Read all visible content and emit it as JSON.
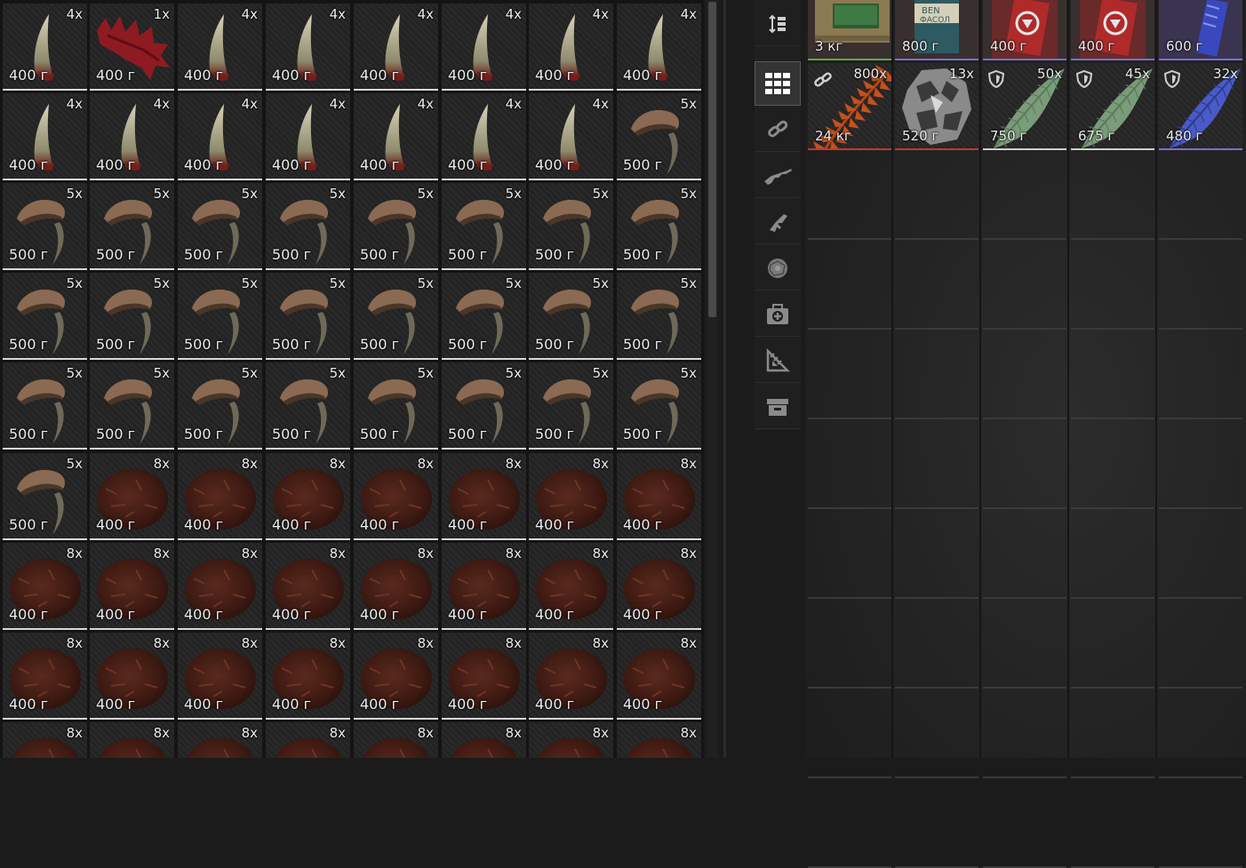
{
  "inventory": {
    "rows": [
      [
        {
          "icon": "fang-icon",
          "count": "4x",
          "weight": "400 г"
        },
        {
          "icon": "red-spine-icon",
          "count": "1x",
          "weight": "400 г"
        },
        {
          "icon": "fang-icon",
          "count": "4x",
          "weight": "400 г"
        },
        {
          "icon": "fang-icon",
          "count": "4x",
          "weight": "400 г"
        },
        {
          "icon": "fang-icon",
          "count": "4x",
          "weight": "400 г"
        },
        {
          "icon": "fang-icon",
          "count": "4x",
          "weight": "400 г"
        },
        {
          "icon": "fang-icon",
          "count": "4x",
          "weight": "400 г"
        },
        {
          "icon": "fang-icon",
          "count": "4x",
          "weight": "400 г"
        }
      ],
      [
        {
          "icon": "fang-icon",
          "count": "4x",
          "weight": "400 г"
        },
        {
          "icon": "fang-icon",
          "count": "4x",
          "weight": "400 г"
        },
        {
          "icon": "fang-icon",
          "count": "4x",
          "weight": "400 г"
        },
        {
          "icon": "fang-icon",
          "count": "4x",
          "weight": "400 г"
        },
        {
          "icon": "fang-icon",
          "count": "4x",
          "weight": "400 г"
        },
        {
          "icon": "fang-icon",
          "count": "4x",
          "weight": "400 г"
        },
        {
          "icon": "fang-icon",
          "count": "4x",
          "weight": "400 г"
        },
        {
          "icon": "claw-icon",
          "count": "5x",
          "weight": "500 г"
        }
      ],
      [
        {
          "icon": "claw-icon",
          "count": "5x",
          "weight": "500 г"
        },
        {
          "icon": "claw-icon",
          "count": "5x",
          "weight": "500 г"
        },
        {
          "icon": "claw-icon",
          "count": "5x",
          "weight": "500 г"
        },
        {
          "icon": "claw-icon",
          "count": "5x",
          "weight": "500 г"
        },
        {
          "icon": "claw-icon",
          "count": "5x",
          "weight": "500 г"
        },
        {
          "icon": "claw-icon",
          "count": "5x",
          "weight": "500 г"
        },
        {
          "icon": "claw-icon",
          "count": "5x",
          "weight": "500 г"
        },
        {
          "icon": "claw-icon",
          "count": "5x",
          "weight": "500 г"
        }
      ],
      [
        {
          "icon": "claw-icon",
          "count": "5x",
          "weight": "500 г"
        },
        {
          "icon": "claw-icon",
          "count": "5x",
          "weight": "500 г"
        },
        {
          "icon": "claw-icon",
          "count": "5x",
          "weight": "500 г"
        },
        {
          "icon": "claw-icon",
          "count": "5x",
          "weight": "500 г"
        },
        {
          "icon": "claw-icon",
          "count": "5x",
          "weight": "500 г"
        },
        {
          "icon": "claw-icon",
          "count": "5x",
          "weight": "500 г"
        },
        {
          "icon": "claw-icon",
          "count": "5x",
          "weight": "500 г"
        },
        {
          "icon": "claw-icon",
          "count": "5x",
          "weight": "500 г"
        }
      ],
      [
        {
          "icon": "claw-icon",
          "count": "5x",
          "weight": "500 г"
        },
        {
          "icon": "claw-icon",
          "count": "5x",
          "weight": "500 г"
        },
        {
          "icon": "claw-icon",
          "count": "5x",
          "weight": "500 г"
        },
        {
          "icon": "claw-icon",
          "count": "5x",
          "weight": "500 г"
        },
        {
          "icon": "claw-icon",
          "count": "5x",
          "weight": "500 г"
        },
        {
          "icon": "claw-icon",
          "count": "5x",
          "weight": "500 г"
        },
        {
          "icon": "claw-icon",
          "count": "5x",
          "weight": "500 г"
        },
        {
          "icon": "claw-icon",
          "count": "5x",
          "weight": "500 г"
        }
      ],
      [
        {
          "icon": "claw-icon",
          "count": "5x",
          "weight": "500 г"
        },
        {
          "icon": "fur-pelt-icon",
          "count": "8x",
          "weight": "400 г"
        },
        {
          "icon": "fur-pelt-icon",
          "count": "8x",
          "weight": "400 г"
        },
        {
          "icon": "fur-pelt-icon",
          "count": "8x",
          "weight": "400 г"
        },
        {
          "icon": "fur-pelt-icon",
          "count": "8x",
          "weight": "400 г"
        },
        {
          "icon": "fur-pelt-icon",
          "count": "8x",
          "weight": "400 г"
        },
        {
          "icon": "fur-pelt-icon",
          "count": "8x",
          "weight": "400 г"
        },
        {
          "icon": "fur-pelt-icon",
          "count": "8x",
          "weight": "400 г"
        }
      ],
      [
        {
          "icon": "fur-pelt-icon",
          "count": "8x",
          "weight": "400 г"
        },
        {
          "icon": "fur-pelt-icon",
          "count": "8x",
          "weight": "400 г"
        },
        {
          "icon": "fur-pelt-icon",
          "count": "8x",
          "weight": "400 г"
        },
        {
          "icon": "fur-pelt-icon",
          "count": "8x",
          "weight": "400 г"
        },
        {
          "icon": "fur-pelt-icon",
          "count": "8x",
          "weight": "400 г"
        },
        {
          "icon": "fur-pelt-icon",
          "count": "8x",
          "weight": "400 г"
        },
        {
          "icon": "fur-pelt-icon",
          "count": "8x",
          "weight": "400 г"
        },
        {
          "icon": "fur-pelt-icon",
          "count": "8x",
          "weight": "400 г"
        }
      ],
      [
        {
          "icon": "fur-pelt-icon",
          "count": "8x",
          "weight": "400 г"
        },
        {
          "icon": "fur-pelt-icon",
          "count": "8x",
          "weight": "400 г"
        },
        {
          "icon": "fur-pelt-icon",
          "count": "8x",
          "weight": "400 г"
        },
        {
          "icon": "fur-pelt-icon",
          "count": "8x",
          "weight": "400 г"
        },
        {
          "icon": "fur-pelt-icon",
          "count": "8x",
          "weight": "400 г"
        },
        {
          "icon": "fur-pelt-icon",
          "count": "8x",
          "weight": "400 г"
        },
        {
          "icon": "fur-pelt-icon",
          "count": "8x",
          "weight": "400 г"
        },
        {
          "icon": "fur-pelt-icon",
          "count": "8x",
          "weight": "400 г"
        }
      ],
      [
        {
          "icon": "fur-pelt-icon",
          "count": "8x",
          "weight": ""
        },
        {
          "icon": "fur-pelt-icon",
          "count": "8x",
          "weight": ""
        },
        {
          "icon": "fur-pelt-icon",
          "count": "8x",
          "weight": ""
        },
        {
          "icon": "fur-pelt-icon",
          "count": "8x",
          "weight": ""
        },
        {
          "icon": "fur-pelt-icon",
          "count": "8x",
          "weight": ""
        },
        {
          "icon": "fur-pelt-icon",
          "count": "8x",
          "weight": ""
        },
        {
          "icon": "fur-pelt-icon",
          "count": "8x",
          "weight": ""
        },
        {
          "icon": "fur-pelt-icon",
          "count": "8x",
          "weight": ""
        }
      ]
    ]
  },
  "filter_tabs": [
    {
      "icon": "sort-icon",
      "active": false
    },
    {
      "icon": "grid-all-icon",
      "active": true
    },
    {
      "icon": "link-icon",
      "active": false
    },
    {
      "icon": "rifle-icon",
      "active": false
    },
    {
      "icon": "pistol-icon",
      "active": false
    },
    {
      "icon": "artifact-icon",
      "active": false
    },
    {
      "icon": "medkit-icon",
      "active": false
    },
    {
      "icon": "tools-icon",
      "active": false
    },
    {
      "icon": "storage-box-icon",
      "active": false
    }
  ],
  "stash": {
    "top_row": [
      {
        "icon": "backpack-icon",
        "count": "",
        "weight": "3 кг",
        "accent": "#5fa84a"
      },
      {
        "icon": "canned-food-icon",
        "count": "",
        "weight": "800 г",
        "accent": "#7b6fd0"
      },
      {
        "icon": "ration-pack-icon",
        "count": "",
        "weight": "400 г",
        "accent": "#7b6fd0"
      },
      {
        "icon": "ration-pack-icon",
        "count": "",
        "weight": "400 г",
        "accent": "#7b6fd0"
      },
      {
        "icon": "blue-package-icon",
        "count": "",
        "weight": "600 г",
        "accent": "#7b6fd0"
      }
    ],
    "second_row": [
      {
        "icon": "orange-fern-icon",
        "count": "800x",
        "weight": "24 кг",
        "accent": "#c0392b",
        "badge": "link-icon"
      },
      {
        "icon": "ore-rock-icon",
        "count": "13x",
        "weight": "520 г",
        "accent": "#c0392b",
        "badge": ""
      },
      {
        "icon": "green-leaf-icon",
        "count": "50x",
        "weight": "750 г",
        "accent": "#cfcfcf",
        "badge": "shield-icon"
      },
      {
        "icon": "green-leaf-icon",
        "count": "45x",
        "weight": "675 г",
        "accent": "#cfcfcf",
        "badge": "shield-icon"
      },
      {
        "icon": "blue-leaf-icon",
        "count": "32x",
        "weight": "480 г",
        "accent": "#7b6fd0",
        "badge": "shield-icon"
      }
    ]
  }
}
